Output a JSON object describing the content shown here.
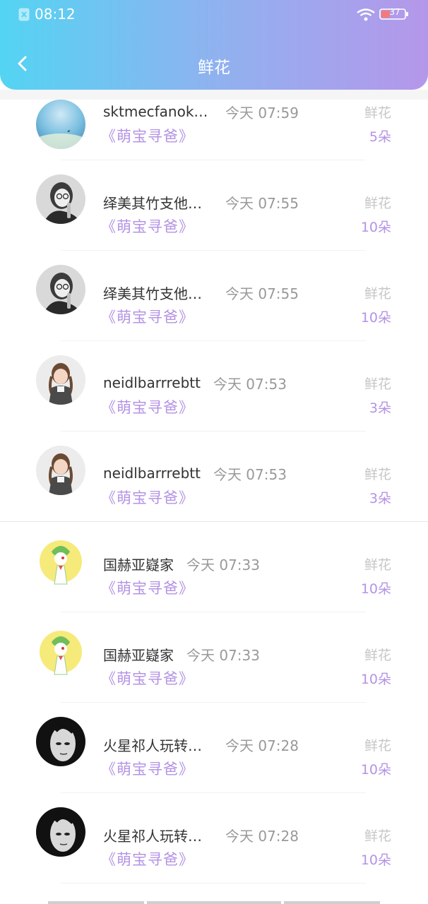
{
  "status_bar": {
    "time": "08:12",
    "battery_level": "37"
  },
  "header": {
    "title": "鲜花"
  },
  "colors": {
    "accent": "#b493e5",
    "gradient_start": "#53d4f3",
    "gradient_end": "#b597ea"
  },
  "items": [
    {
      "name": "sktmecfanokricci",
      "time": "今天 07:59",
      "work": "《萌宝寻爸》",
      "gift_type": "鲜花",
      "count": "5朵",
      "avatar": "sky-photo"
    },
    {
      "name": "绎美其竹支他配…",
      "time": "今天 07:55",
      "work": "《萌宝寻爸》",
      "gift_type": "鲜花",
      "count": "10朵",
      "avatar": "woman-glasses-photo"
    },
    {
      "name": "绎美其竹支他配…",
      "time": "今天 07:55",
      "work": "《萌宝寻爸》",
      "gift_type": "鲜花",
      "count": "10朵",
      "avatar": "woman-glasses-photo"
    },
    {
      "name": "neidlbarrrebtt",
      "time": "今天 07:53",
      "work": "《萌宝寻爸》",
      "gift_type": "鲜花",
      "count": "3朵",
      "avatar": "girl-braids-photo"
    },
    {
      "name": "neidlbarrrebtt",
      "time": "今天 07:53",
      "work": "《萌宝寻爸》",
      "gift_type": "鲜花",
      "count": "3朵",
      "avatar": "girl-braids-photo"
    },
    {
      "name": "国赫亚嶷家",
      "time": "今天 07:33",
      "work": "《萌宝寻爸》",
      "gift_type": "鲜花",
      "count": "10朵",
      "avatar": "cartoon-character"
    },
    {
      "name": "国赫亚嶷家",
      "time": "今天 07:33",
      "work": "《萌宝寻爸》",
      "gift_type": "鲜花",
      "count": "10朵",
      "avatar": "cartoon-character"
    },
    {
      "name": "火星祁人玩转地…",
      "time": "今天 07:28",
      "work": "《萌宝寻爸》",
      "gift_type": "鲜花",
      "count": "10朵",
      "avatar": "mask-face-photo"
    },
    {
      "name": "火星祁人玩转地…",
      "time": "今天 07:28",
      "work": "《萌宝寻爸》",
      "gift_type": "鲜花",
      "count": "10朵",
      "avatar": "mask-face-photo"
    }
  ]
}
